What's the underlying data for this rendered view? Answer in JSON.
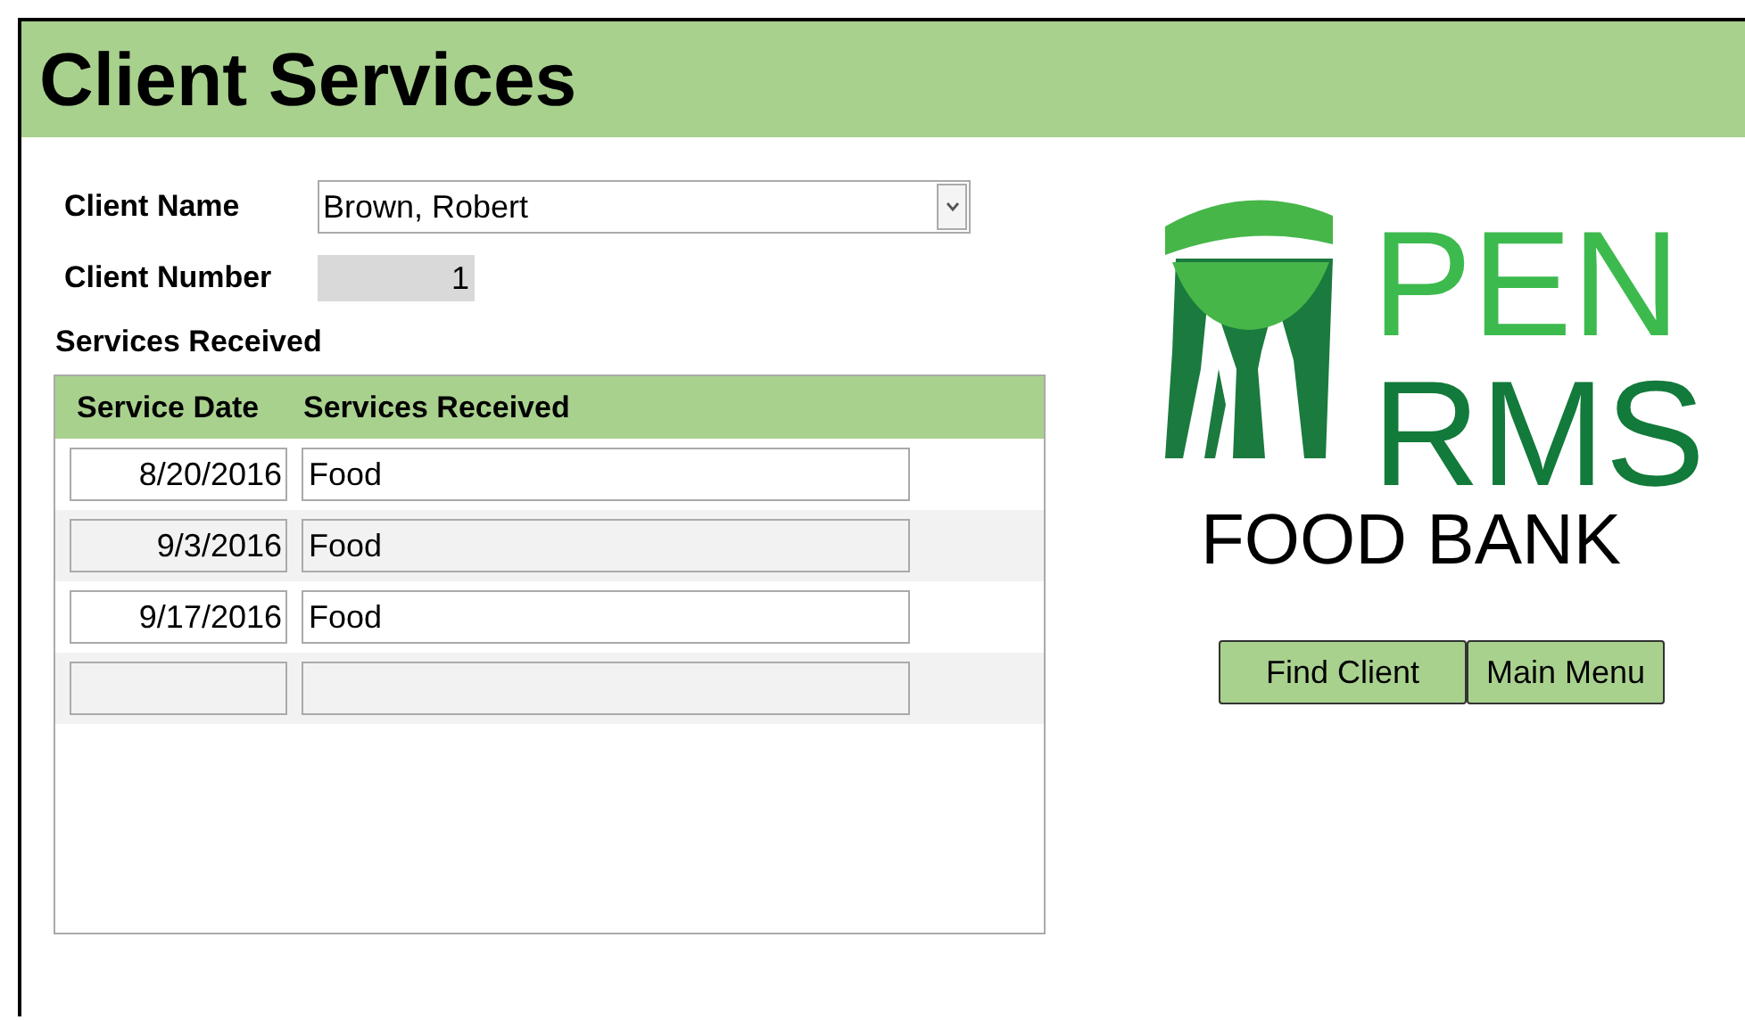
{
  "header": {
    "title": "Client Services"
  },
  "client": {
    "name_label": "Client Name",
    "name_value": "Brown, Robert",
    "number_label": "Client Number",
    "number_value": "1"
  },
  "services": {
    "title": "Services Received",
    "columns": [
      "Service Date",
      "Services Received"
    ],
    "rows": [
      {
        "date": "8/20/2016",
        "service": "Food"
      },
      {
        "date": "9/3/2016",
        "service": "Food"
      },
      {
        "date": "9/17/2016",
        "service": "Food"
      }
    ]
  },
  "logo": {
    "line_1": "PEN",
    "line_2": "RMS",
    "line_3": "FOOD BANK"
  },
  "buttons": [
    "Find Client",
    "Main Menu"
  ]
}
